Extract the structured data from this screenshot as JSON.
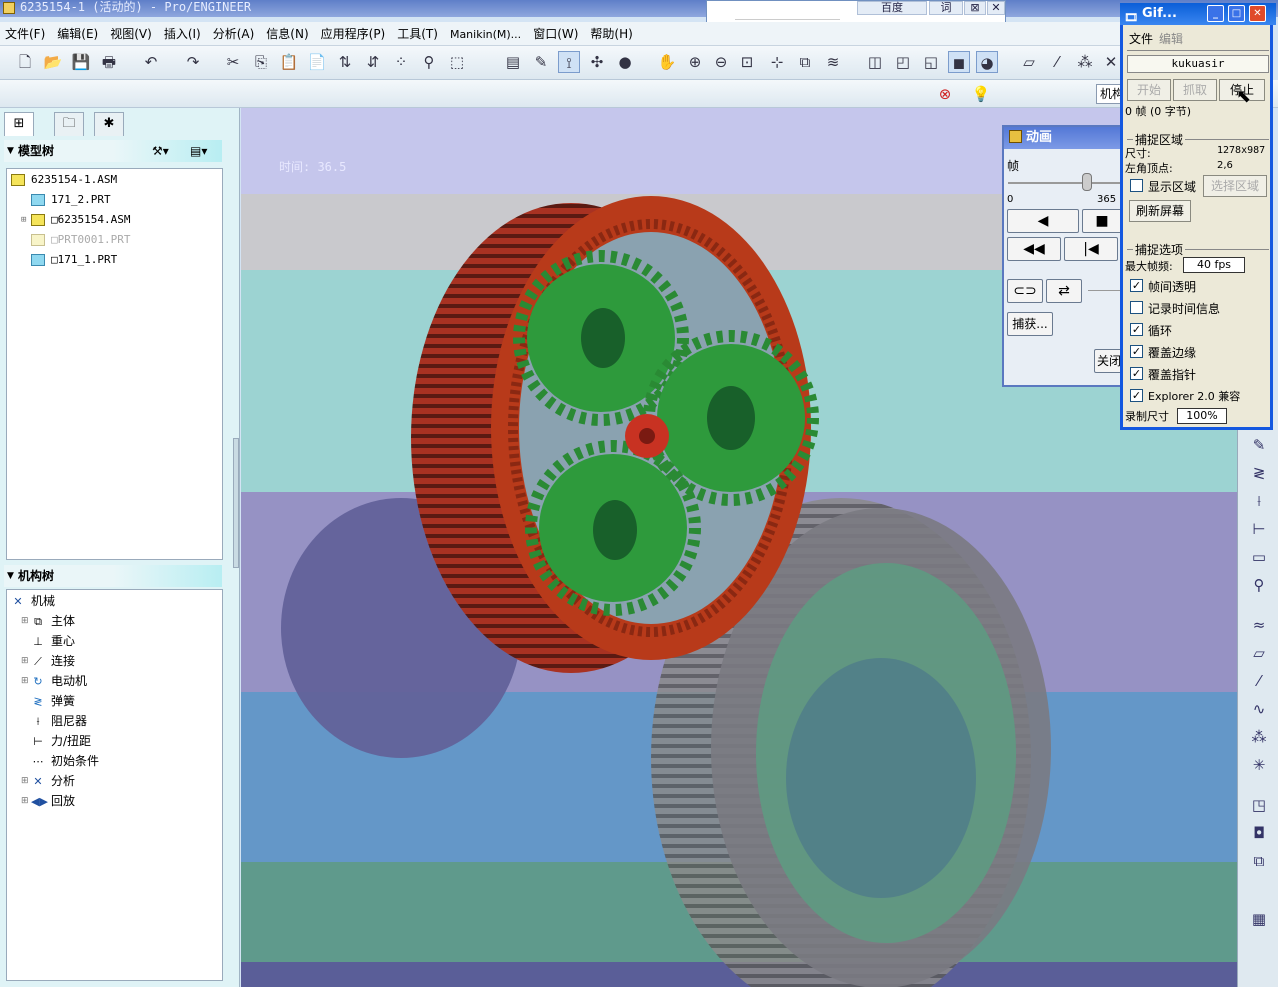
{
  "window": {
    "title": "6235154-1 (活动的) - Pro/ENGINEER"
  },
  "browser_popup": {
    "btn1": "百度",
    "btn2": "词",
    "btn3": "⊠",
    "close": "✕"
  },
  "menu": [
    "文件(F)",
    "编辑(E)",
    "视图(V)",
    "插入(I)",
    "分析(A)",
    "信息(N)",
    "应用程序(P)",
    "工具(T)",
    "Manikin(M)...",
    "窗口(W)",
    "帮助(H)"
  ],
  "toolbar2": {
    "mech_label": "机构"
  },
  "model_tree": {
    "header": "模型树",
    "items": [
      "6235154-1.ASM",
      "171_2.PRT",
      "□6235154.ASM",
      "□PRT0001.PRT",
      "□171_1.PRT"
    ]
  },
  "mech_tree": {
    "header": "机构树",
    "items": [
      "机械",
      "主体",
      "重心",
      "连接",
      "电动机",
      "弹簧",
      "阻尼器",
      "力/扭距",
      "初始条件",
      "分析",
      "回放"
    ]
  },
  "viewport": {
    "time_label": "时间: 36.5"
  },
  "animation": {
    "title": "动画",
    "frame_label": "帧",
    "slider_min": "0",
    "slider_max": "365",
    "capture_button": "捕获...",
    "close_button": "关闭"
  },
  "gif_recorder": {
    "title": "Gif...",
    "menu": [
      "文件",
      "编辑"
    ],
    "name": "kukuasir",
    "start": "开始",
    "grab": "抓取",
    "stop": "停止",
    "frame_info": "0 帧 (0 字节)",
    "capture_area_header": "捕捉区域",
    "size_label": "尺寸:",
    "size_value": "1278x987",
    "corner_label": "左角顶点:",
    "corner_value": "2,6",
    "show_area": "显示区域",
    "select_area": "选择区域",
    "refresh": "刷新屏幕",
    "capture_opts_header": "捕捉选项",
    "max_fps_label": "最大帧频:",
    "max_fps_value": "40 fps",
    "opt_transparent": "帧间透明",
    "opt_timeinfo": "记录时间信息",
    "opt_loop": "循环",
    "opt_edges": "覆盖边缘",
    "opt_pointer": "覆盖指针",
    "opt_explorer": "Explorer 2.0 兼容",
    "rec_size_label": "录制尺寸",
    "rec_size_value": "100%",
    "checks": {
      "transparent": true,
      "timeinfo": false,
      "loop": true,
      "edges": true,
      "pointer": true,
      "explorer": true,
      "show_area": false
    }
  },
  "colors": {
    "accent": "#1458e0",
    "gear_green": "#2e9a3c",
    "ring_gear": "#b83a1a"
  }
}
